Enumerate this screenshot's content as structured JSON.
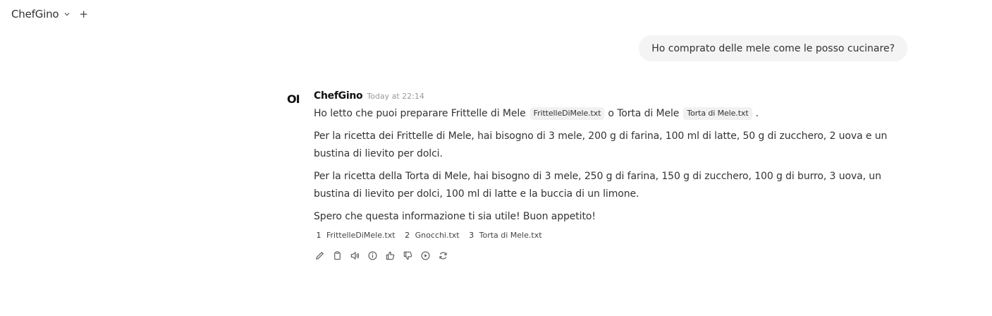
{
  "topbar": {
    "model_name": "ChefGino",
    "new_chat_label": "+"
  },
  "user_message": {
    "text": "Ho comprato delle mele come le posso cucinare?"
  },
  "assistant": {
    "avatar": "OI",
    "name": "ChefGino",
    "timestamp": "Today at 22:14",
    "p1": {
      "before": "Ho letto che puoi preparare Frittelle di Mele",
      "cite1": "FrittelleDiMele.txt",
      "middle": "o Torta di Mele",
      "cite2": "Torta di Mele.txt",
      "after": "."
    },
    "p2": "Per la ricetta dei Frittelle di Mele, hai bisogno di 3 mele, 200 g di farina, 100 ml di latte, 50 g di zucchero, 2 uova e un bustina di lievito per dolci.",
    "p3": "Per la ricetta della Torta di Mele, hai bisogno di 3 mele, 250 g di farina, 150 g di zucchero, 100 g di burro, 3 uova, un bustina di lievito per dolci, 100 ml di latte e la buccia di un limone.",
    "p4": "Spero che questa informazione ti sia utile! Buon appetito!",
    "sources": [
      {
        "num": "1",
        "name": "FrittelleDiMele.txt"
      },
      {
        "num": "2",
        "name": "Gnocchi.txt"
      },
      {
        "num": "3",
        "name": "Torta di Mele.txt"
      }
    ],
    "actions": [
      "edit-icon",
      "copy-icon",
      "speaker-icon",
      "info-icon",
      "thumbs-up-icon",
      "thumbs-down-icon",
      "play-icon",
      "regenerate-icon"
    ]
  }
}
